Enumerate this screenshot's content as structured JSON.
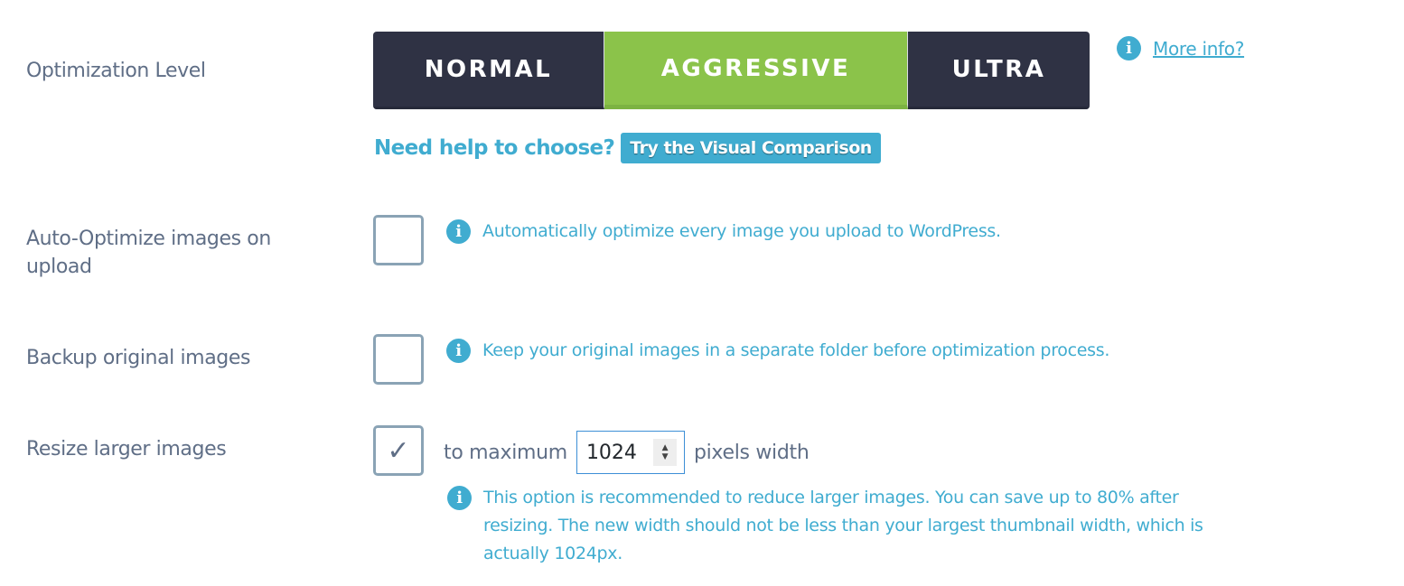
{
  "optimization_level": {
    "label": "Optimization Level",
    "options": [
      {
        "label": "NORMAL",
        "active": false
      },
      {
        "label": "AGGRESSIVE",
        "active": true
      },
      {
        "label": "ULTRA",
        "active": false
      }
    ],
    "more_info_icon": "info-icon",
    "more_info_link": "More info?",
    "help_text": "Need help to choose?",
    "visual_comparison_button": "Try the Visual Comparison"
  },
  "auto_optimize": {
    "label_line1": "Auto-Optimize images on",
    "label_line2": "upload",
    "checked": false,
    "description": "Automatically optimize every image you upload to WordPress."
  },
  "backup": {
    "label": "Backup original images",
    "checked": false,
    "description": "Keep your original images in a separate folder before optimization process."
  },
  "resize": {
    "label": "Resize larger images",
    "checked": true,
    "checkmark": "✓",
    "prefix": "to maximum",
    "value": "1024",
    "suffix": "pixels width",
    "description_line1": "This option is recommended to reduce larger images. You can save up to 80% after",
    "description_line2": "resizing. The new width should not be less than your largest thumbnail width, which is",
    "description_line3": "actually 1024px."
  },
  "colors": {
    "accent": "#40acd0",
    "active_segment": "#8bc34a",
    "inactive_segment": "#2f3244",
    "label_text": "#5f6e86"
  }
}
